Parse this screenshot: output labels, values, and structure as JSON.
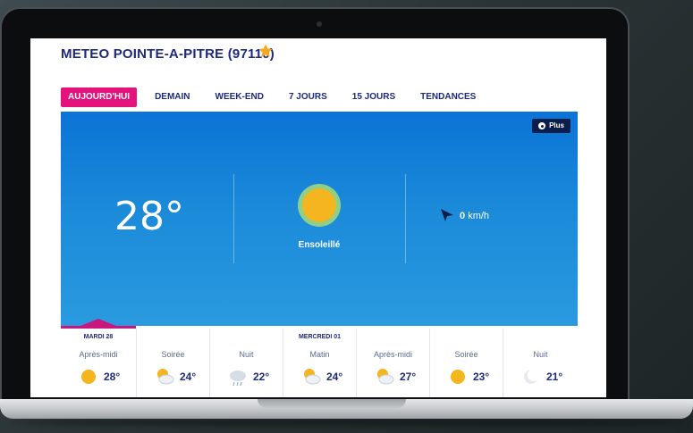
{
  "page": {
    "title": "METEO POINTE-A-PITRE (97110)",
    "favorite_icon": "star-icon",
    "accent": "#e3127d",
    "brand": "#1d2a7a"
  },
  "tabs": [
    {
      "label": "AUJOURD'HUI",
      "active": true
    },
    {
      "label": "DEMAIN"
    },
    {
      "label": "WEEK-END"
    },
    {
      "label": "7 JOURS"
    },
    {
      "label": "15 JOURS"
    },
    {
      "label": "TENDANCES"
    }
  ],
  "current": {
    "temperature": "28°",
    "condition": "Ensoleillé",
    "condition_icon": "sun-icon",
    "wind_value": "0",
    "wind_unit": "km/h",
    "wind_icon": "wind-direction-arrow-icon",
    "plus_label": "Plus"
  },
  "forecast": [
    {
      "day": "MARDI 28",
      "period": "Après-midi",
      "temp": "28°",
      "icon": "sun-icon"
    },
    {
      "day": "",
      "period": "Soirée",
      "temp": "24°",
      "icon": "sun-cloud-icon"
    },
    {
      "day": "",
      "period": "Nuit",
      "temp": "22°",
      "icon": "cloud-rain-icon"
    },
    {
      "day": "MERCREDI 01",
      "period": "Matin",
      "temp": "24°",
      "icon": "sun-cloud-icon"
    },
    {
      "day": "",
      "period": "Après-midi",
      "temp": "27°",
      "icon": "sun-cloud-icon"
    },
    {
      "day": "",
      "period": "Soirée",
      "temp": "23°",
      "icon": "sun-icon"
    },
    {
      "day": "",
      "period": "Nuit",
      "temp": "21°",
      "icon": "moon-icon"
    }
  ]
}
